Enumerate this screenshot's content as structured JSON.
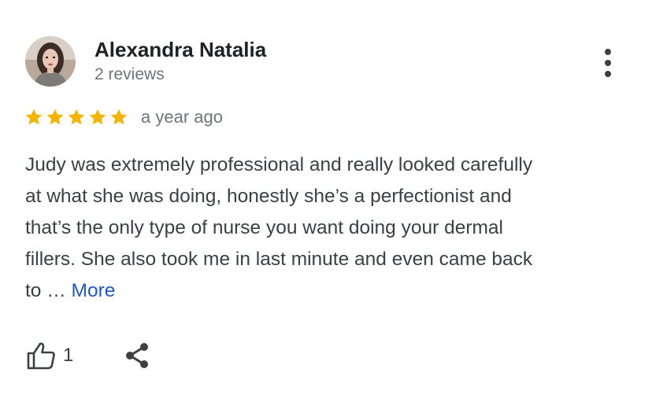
{
  "author": {
    "name": "Alexandra Natalia",
    "meta": "2 reviews",
    "avatar": "avatar-photo"
  },
  "review": {
    "rating": 5,
    "rating_max": 5,
    "time": "a year ago",
    "lines": [
      "Judy was extremely professional and really looked carefully",
      "at what she was doing, honestly she’s a perfectionist and",
      "that’s the only type of nurse you want doing your dermal",
      "fillers. She also took me in last minute and even came back",
      "to … "
    ],
    "more_label": "More"
  },
  "actions": {
    "like_icon": "thumbs-up-icon",
    "like_count": "1",
    "share_icon": "share-icon",
    "menu_icon": "more-vert-icon"
  },
  "colors": {
    "star": "#F4B400",
    "link": "#1A59C7",
    "secondary_text": "#70757A",
    "body_text": "#3C4043"
  }
}
